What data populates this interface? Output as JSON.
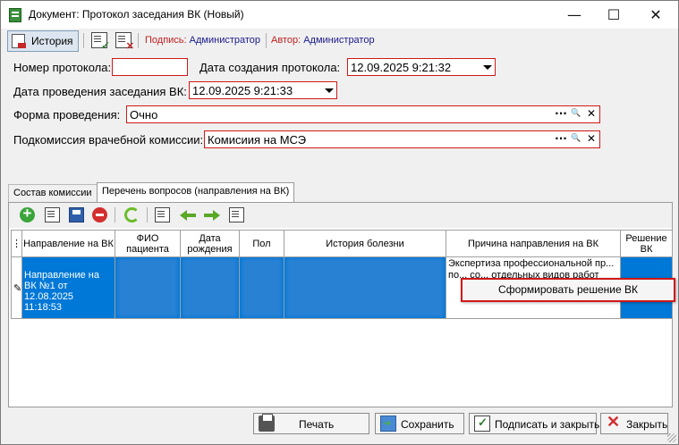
{
  "window": {
    "title": "Документ: Протокол заседания ВК (Новый)",
    "minimize": "—",
    "maximize": "☐",
    "close": "✕"
  },
  "toolbar": {
    "history_label": "История",
    "signed_prefix": "Подпись:",
    "signed_by": "Администратор",
    "author_prefix": "Автор:",
    "author_name": "Администратор"
  },
  "form": {
    "protocol_number_label": "Номер протокола:",
    "protocol_number_value": "",
    "created_label": "Дата создания протокола:",
    "created_value": "12.09.2025 9:21:32",
    "meeting_date_label": "Дата проведения заседания ВК:",
    "meeting_date_value": "12.09.2025 9:21:33",
    "form_label": "Форма проведения:",
    "form_value": "Очно",
    "subcommission_label": "Подкомиссия врачебной комиссии:",
    "subcommission_value": "Комисиия на МСЭ",
    "lookup_more": "···",
    "lookup_search": "🔍",
    "lookup_clear": "✕"
  },
  "tabs": [
    {
      "label": "Состав комиссии"
    },
    {
      "label": "Перечень вопросов (направления на ВК)"
    }
  ],
  "grid": {
    "columns": [
      "Направление на ВК",
      "ФИО пациента",
      "Дата рождения",
      "Пол",
      "История болезни",
      "Причина направления на ВК",
      "Решение ВК"
    ],
    "rows": [
      {
        "referral": "Направление на ВК №1 от 12.08.2025 11:18:53",
        "patient": "",
        "birth_date": "",
        "sex": "",
        "history": "",
        "reason": "Экспертиза профессиональной пр... по... со... отдельных видов работ",
        "decision": ""
      }
    ]
  },
  "context_menu": {
    "item": "Сформировать решение ВК"
  },
  "buttons": {
    "print": "Печать",
    "save": "Сохранить",
    "sign_close": "Подписать и закрыть",
    "close": "Закрыть"
  }
}
